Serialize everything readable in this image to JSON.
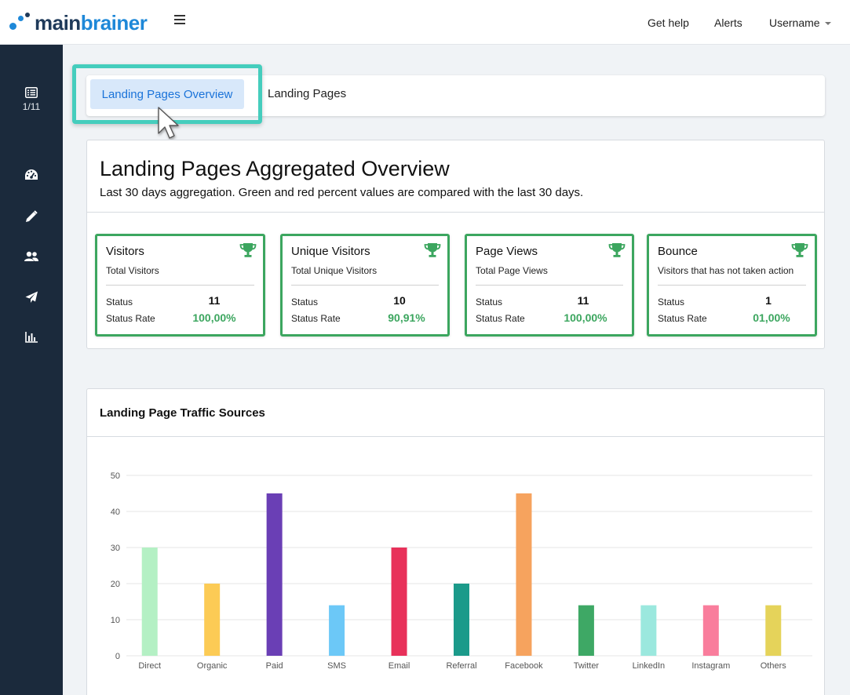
{
  "header": {
    "logo_main": "main",
    "logo_brand": "brainer",
    "get_help": "Get help",
    "alerts": "Alerts",
    "username": "Username"
  },
  "sidebar": {
    "counter": "1/11",
    "items": [
      {
        "icon": "list-icon"
      },
      {
        "icon": "dashboard-icon"
      },
      {
        "icon": "pencil-icon"
      },
      {
        "icon": "users-icon"
      },
      {
        "icon": "paper-plane-icon"
      },
      {
        "icon": "bar-chart-icon"
      }
    ]
  },
  "tabs": {
    "active": "Landing Pages Overview",
    "other": "Landing Pages"
  },
  "overview": {
    "title": "Landing Pages Aggregated Overview",
    "subtitle": "Last 30 days aggregation. Green and red percent values are compared with the last 30 days.",
    "status_label": "Status",
    "status_rate_label": "Status Rate",
    "cards": [
      {
        "title": "Visitors",
        "subtitle": "Total Visitors",
        "status": "11",
        "rate": "100,00%"
      },
      {
        "title": "Unique Visitors",
        "subtitle": "Total Unique Visitors",
        "status": "10",
        "rate": "90,91%"
      },
      {
        "title": "Page Views",
        "subtitle": "Total Page Views",
        "status": "11",
        "rate": "100,00%"
      },
      {
        "title": "Bounce",
        "subtitle": "Visitors that has not taken action",
        "status": "1",
        "rate": "01,00%"
      }
    ]
  },
  "colors": {
    "accent_blue": "#1a73d9",
    "success_green": "#3ca65f",
    "highlight_teal": "#45cdbd",
    "sidebar_bg": "#1b2a3c"
  },
  "chart_data": {
    "type": "bar",
    "title": "Landing Page Traffic Sources",
    "categories": [
      "Direct",
      "Organic",
      "Paid",
      "SMS",
      "Email",
      "Referral",
      "Facebook",
      "Twitter",
      "LinkedIn",
      "Instagram",
      "Others"
    ],
    "values": [
      30,
      20,
      45,
      14,
      30,
      20,
      45,
      14,
      14,
      14,
      14
    ],
    "colors": [
      "#b4f0c4",
      "#fccb55",
      "#6a3fb5",
      "#6cc8f7",
      "#e8315a",
      "#1b9a8a",
      "#f6a35e",
      "#3ea865",
      "#9be8de",
      "#f97d9c",
      "#e5d35a"
    ],
    "yticks": [
      0,
      10,
      20,
      30,
      40,
      50
    ],
    "ylim": [
      0,
      50
    ],
    "grid": true,
    "legend": "none"
  }
}
